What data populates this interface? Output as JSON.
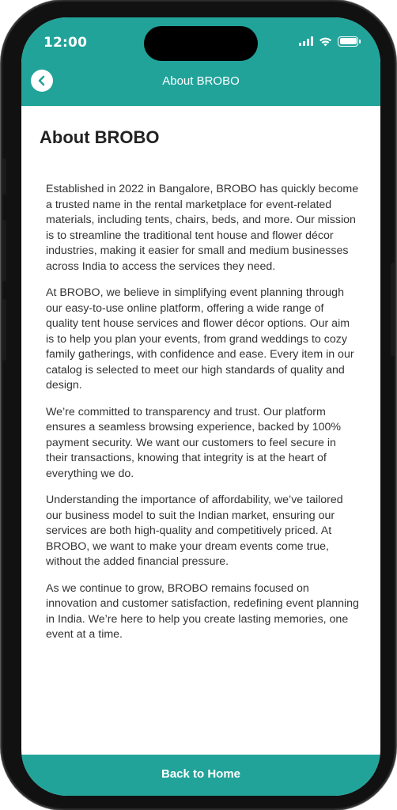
{
  "status_bar": {
    "time": "12:00",
    "icons": [
      "signal-icon",
      "wifi-icon",
      "battery-icon"
    ]
  },
  "header": {
    "title": "About BROBO",
    "back_icon": "back-arrow-icon",
    "color": "#21a39a"
  },
  "main": {
    "title": "About BROBO",
    "paragraphs": [
      "Established in 2022 in Bangalore, BROBO has quickly become a trusted name in the rental marketplace for event-related materials, including tents, chairs, beds, and more. Our mission is to streamline the traditional tent house and flower décor industries, making it easier for small and medium businesses across India to access the services they need.",
      "At BROBO, we believe in simplifying event planning through our easy-to-use online platform, offering a wide range of quality tent house services and flower décor options. Our aim is to help you plan your events, from grand weddings to cozy family gatherings, with confidence and ease. Every item in our catalog is selected to meet our high standards of quality and design.",
      "We’re committed to transparency and trust. Our platform ensures a seamless browsing experience, backed by 100% payment security. We want our customers to feel secure in their transactions, knowing that integrity is at the heart of everything we do.",
      "Understanding the importance of affordability, we’ve tailored our business model to suit the Indian market, ensuring our services are both high-quality and competitively priced. At BROBO, we want to make your dream events come true, without the added financial pressure.",
      "As we continue to grow, BROBO remains focused on innovation and customer satisfaction, redefining event planning in India. We’re here to help you create lasting memories, one event at a time."
    ]
  },
  "footer": {
    "button_label": "Back to Home",
    "color": "#21a39a"
  }
}
